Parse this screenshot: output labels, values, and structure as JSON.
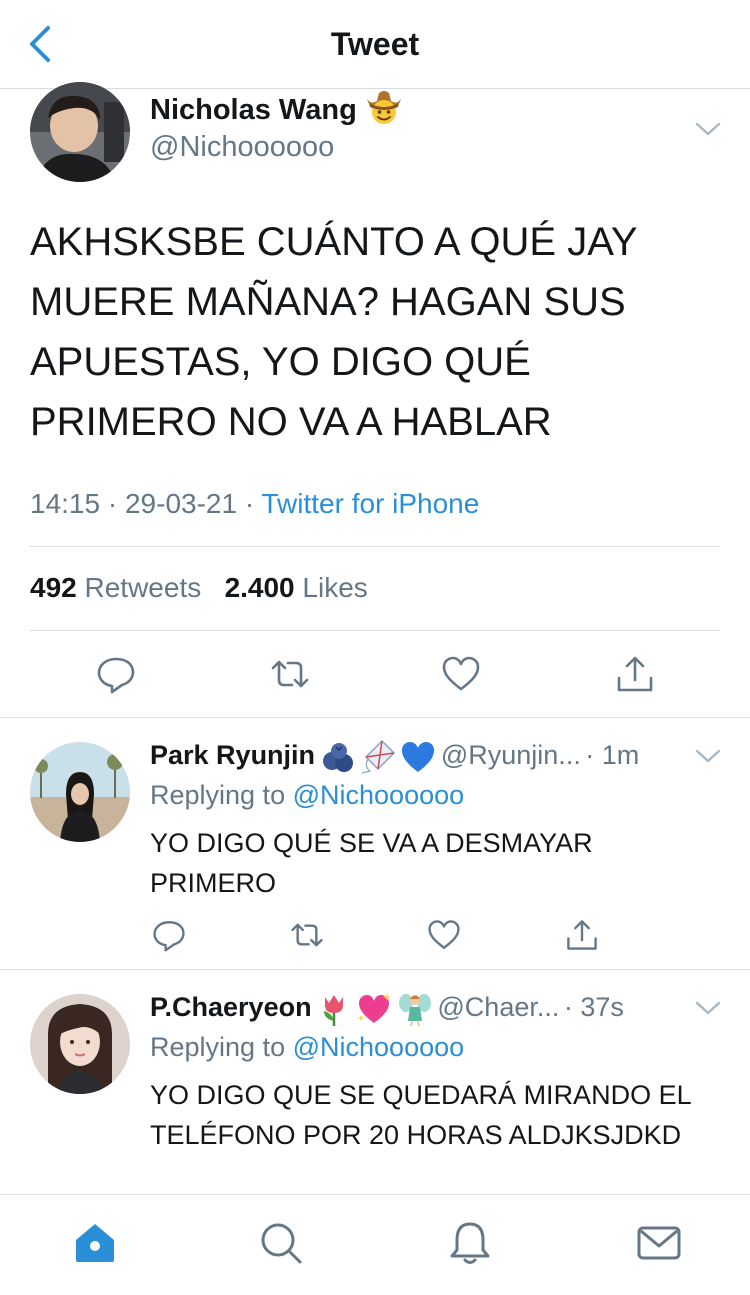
{
  "header": {
    "title": "Tweet"
  },
  "main_tweet": {
    "name": "Nicholas Wang",
    "handle": "@Nichoooooo",
    "text": "AKHSKSBE CUÁNTO A QUÉ JAY MUERE MAÑANA? HAGAN SUS APUESTAS, YO DIGO QUÉ PRIMERO NO VA A HABLAR",
    "time": "14:15",
    "date": "29-03-21",
    "source": "Twitter for iPhone",
    "retweets_count": "492",
    "retweets_label": "Retweets",
    "likes_count": "2.400",
    "likes_label": "Likes"
  },
  "replies": [
    {
      "name": "Park Ryunjin",
      "handle": "@Ryunjin...",
      "age": "1m",
      "replying_label": "Replying to",
      "replying_to": "@Nichoooooo",
      "text": "YO DIGO QUÉ SE VA A DESMAYAR PRIMERO"
    },
    {
      "name": "P.Chaeryeon",
      "handle": "@Chaer...",
      "age": "37s",
      "replying_label": "Replying to",
      "replying_to": "@Nichoooooo",
      "text": "YO DIGO QUE SE QUEDARÁ MIRANDO EL TELÉFONO  POR 20 HORAS ALDJKSJDKD"
    }
  ],
  "colors": {
    "accent": "#2a8fd7",
    "text": "#14171a",
    "muted": "#657786",
    "divider": "#d9dde1"
  },
  "icons": [
    "back-chevron-icon",
    "cowboy-emoji-icon",
    "chevron-down-icon",
    "reply-icon",
    "retweet-icon",
    "like-icon",
    "share-icon",
    "blueberries-emoji-icon",
    "kite-emoji-icon",
    "blue-heart-emoji-icon",
    "tulip-emoji-icon",
    "sparkling-heart-emoji-icon",
    "fairy-emoji-icon",
    "home-tab-icon",
    "search-tab-icon",
    "notifications-tab-icon",
    "messages-tab-icon"
  ]
}
